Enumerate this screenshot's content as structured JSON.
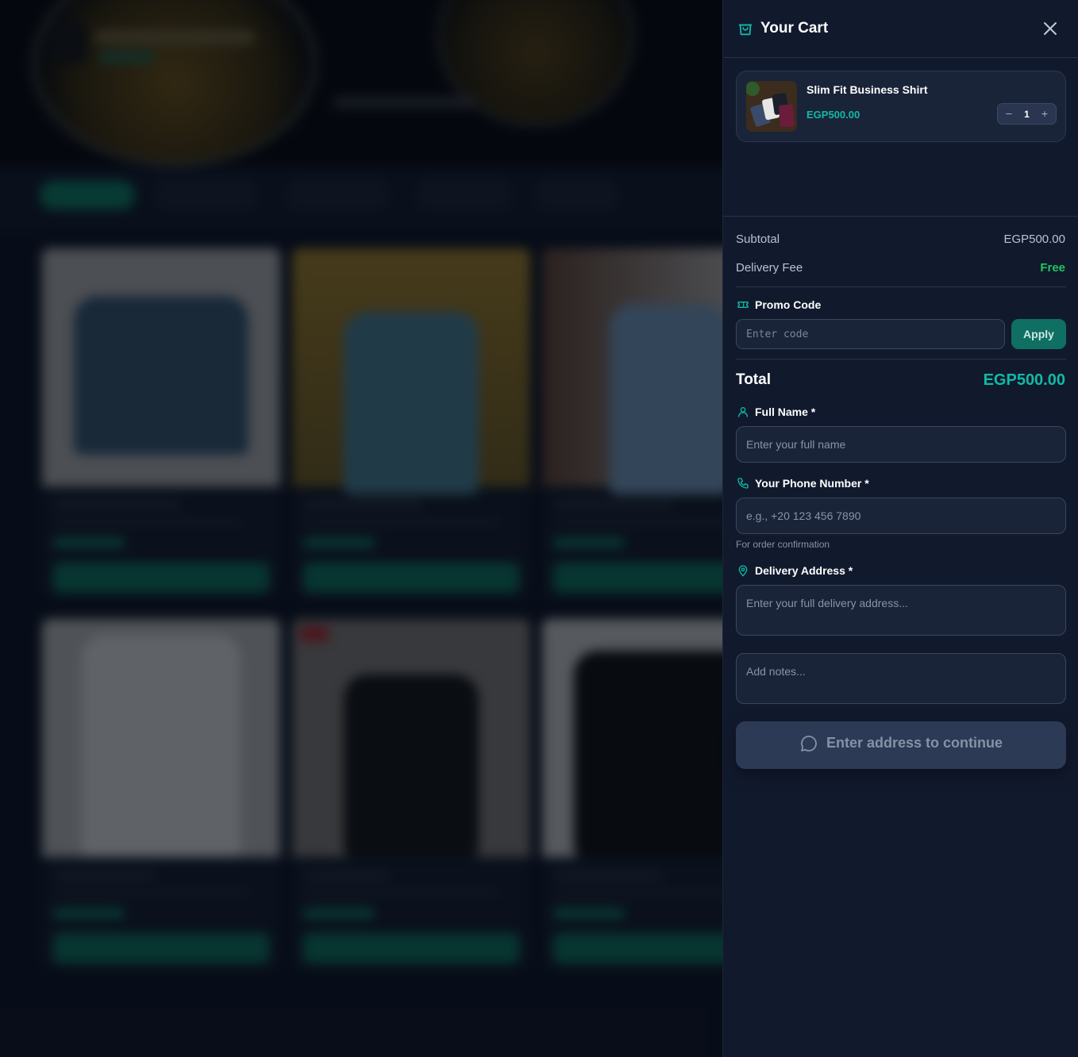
{
  "cart": {
    "title": "Your Cart",
    "icons": {
      "bag": "shopping-bag-icon",
      "close": "close-icon"
    },
    "items": [
      {
        "name": "Slim Fit Business Shirt",
        "price": "EGP500.00",
        "quantity": "1",
        "minus": "−",
        "plus": "+"
      }
    ],
    "summary": {
      "subtotal_label": "Subtotal",
      "subtotal_value": "EGP500.00",
      "delivery_label": "Delivery Fee",
      "delivery_value": "Free"
    },
    "promo": {
      "label": "Promo Code",
      "placeholder": "Enter code",
      "apply_label": "Apply"
    },
    "total": {
      "label": "Total",
      "value": "EGP500.00"
    },
    "form": {
      "full_name": {
        "label": "Full Name *",
        "placeholder": "Enter your full name"
      },
      "phone": {
        "label": "Your Phone Number *",
        "placeholder": "e.g., +20 123 456 7890",
        "hint": "For order confirmation"
      },
      "address": {
        "label": "Delivery Address *",
        "placeholder": "Enter your full delivery address..."
      },
      "notes": {
        "placeholder": "Add notes..."
      }
    },
    "submit_label": "Enter address to continue",
    "colors": {
      "accent": "#14b8a6",
      "free": "#22c55e",
      "panel_bg": "#111a2d",
      "apply_bg": "#0f6f63",
      "submit_disabled_bg": "#2c3a55"
    }
  }
}
